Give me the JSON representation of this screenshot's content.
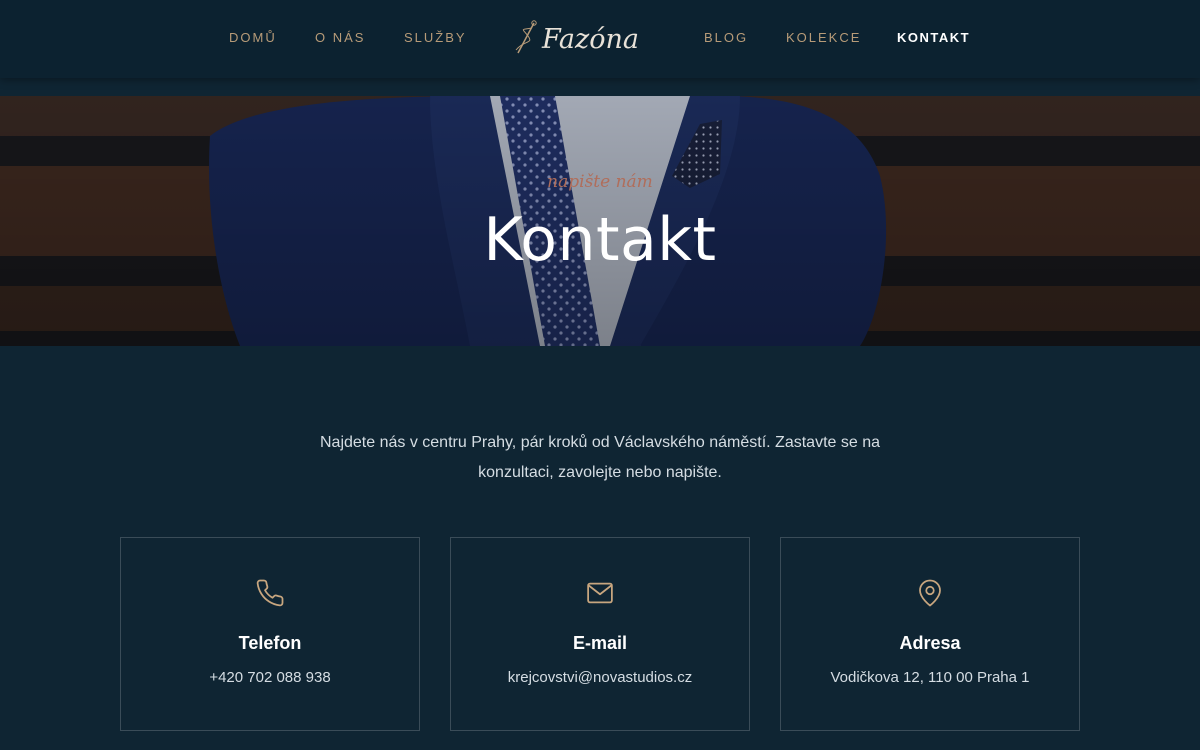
{
  "nav": {
    "items": [
      {
        "label": "DOMŮ"
      },
      {
        "label": "O NÁS"
      },
      {
        "label": "SLUŽBY"
      },
      {
        "label": "BLOG"
      },
      {
        "label": "KOLEKCE"
      },
      {
        "label": "KONTAKT"
      }
    ],
    "logo_text": "Fazóna"
  },
  "hero": {
    "kicker": "napište nám",
    "title": "Kontakt"
  },
  "intro": "Najdete nás v centru Prahy, pár kroků od Václavského náměstí. Zastavte se na konzultaci, zavolejte nebo napište.",
  "cards": [
    {
      "icon": "phone-icon",
      "title": "Telefon",
      "value": "+420 702 088 938"
    },
    {
      "icon": "mail-icon",
      "title": "E-mail",
      "value": "krejcovstvi@novastudios.cz"
    },
    {
      "icon": "map-pin-icon",
      "title": "Adresa",
      "value": "Vodičkova 12, 110 00 Praha 1"
    }
  ],
  "colors": {
    "background": "#0f2533",
    "nav_bg": "#0c2230",
    "accent_gold": "#b79b78",
    "kicker": "#b06e5b",
    "card_border": "#3a4c58"
  }
}
